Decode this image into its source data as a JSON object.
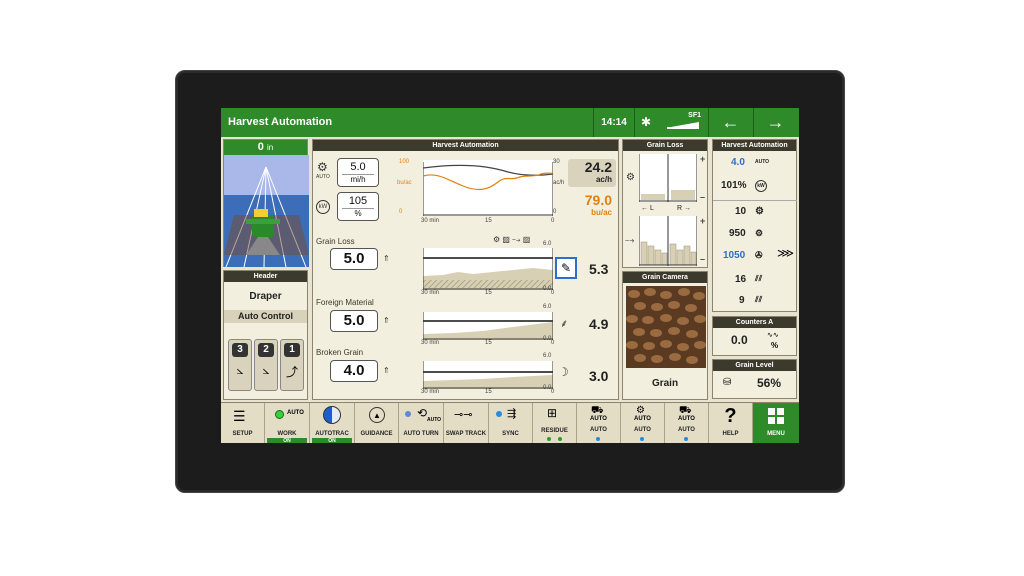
{
  "topbar": {
    "title": "Harvest Automation",
    "time": "14:14",
    "sf_label": "SF1",
    "back_icon": "←",
    "forward_icon": "→"
  },
  "left": {
    "height_value": "0",
    "height_unit": "in",
    "header_title": "Header",
    "header_value": "Draper",
    "auto_control": "Auto Control",
    "buttons": [
      "3",
      "2",
      "1"
    ]
  },
  "center": {
    "title": "Harvest Automation",
    "speed_value": "5.0",
    "speed_unit": "mi/h",
    "auto_label": "AUTO",
    "power_value": "105",
    "power_unit": "%",
    "chart_top": {
      "y_left_max": "100",
      "y_left_unit": "bu/ac",
      "y_left_min": "0",
      "y_right_max": "30",
      "y_right_unit": "ac/h",
      "y_right_min": "0",
      "x_left": "30 min",
      "x_mid": "15",
      "x_right": "0"
    },
    "rate_value": "24.2",
    "rate_unit": "ac/h",
    "yield_value": "79.0",
    "yield_unit": "bu/ac",
    "grain_loss": {
      "label": "Grain Loss",
      "set": "5.0",
      "value": "5.3",
      "ymax": "6.0",
      "ymin": "0.0",
      "x_left": "30 min",
      "x_mid": "15",
      "x_right": "0"
    },
    "foreign": {
      "label": "Foreign Material",
      "set": "5.0",
      "value": "4.9",
      "ymax": "6.0",
      "ymin": "0.0",
      "x_left": "30 min",
      "x_mid": "15",
      "x_right": "0"
    },
    "broken": {
      "label": "Broken Grain",
      "set": "4.0",
      "value": "3.0",
      "ymax": "6.0",
      "ymin": "0.0",
      "x_left": "30 min",
      "x_mid": "15",
      "x_right": "0"
    }
  },
  "grain_loss_panel": {
    "title": "Grain Loss",
    "left": "L",
    "right": "R",
    "plus": "+",
    "minus": "–"
  },
  "grain_camera": {
    "title": "Grain Camera",
    "caption": "Grain"
  },
  "ha_panel": {
    "title": "Harvest Automation",
    "rows": [
      {
        "value": "4.0",
        "tag": "AUTO",
        "blue": true
      },
      {
        "value": "101%",
        "tag": "kW",
        "blue": false
      },
      {
        "value": "10",
        "tag": "",
        "blue": false
      },
      {
        "value": "950",
        "tag": "r/min",
        "blue": false
      },
      {
        "value": "1050",
        "tag": "r/min",
        "blue": true
      },
      {
        "value": "16",
        "tag": "",
        "blue": false
      },
      {
        "value": "9",
        "tag": "",
        "blue": false
      }
    ]
  },
  "counters": {
    "title": "Counters A",
    "value": "0.0",
    "unit": "%"
  },
  "grain_level": {
    "title": "Grain Level",
    "value": "56%"
  },
  "bottom": {
    "setup": "SETUP",
    "work": "WORK",
    "work_auto": "AUTO",
    "work_state": "ON",
    "autotrac": "AUTOTRAC",
    "autotrac_state": "ON",
    "guidance": "GUIDANCE",
    "auto_turn": "AUTO TURN",
    "auto_turn_tag": "AUTO",
    "swap_track": "SWAP TRACK",
    "sync": "SYNC",
    "residue": "RESIDUE",
    "auto1": "AUTO",
    "auto1_sub": "AUTO",
    "auto2": "AUTO",
    "auto2_sub": "AUTO",
    "auto3": "AUTO",
    "auto3_sub": "AUTO",
    "help": "HELP",
    "help_glyph": "?",
    "menu": "MENU"
  }
}
